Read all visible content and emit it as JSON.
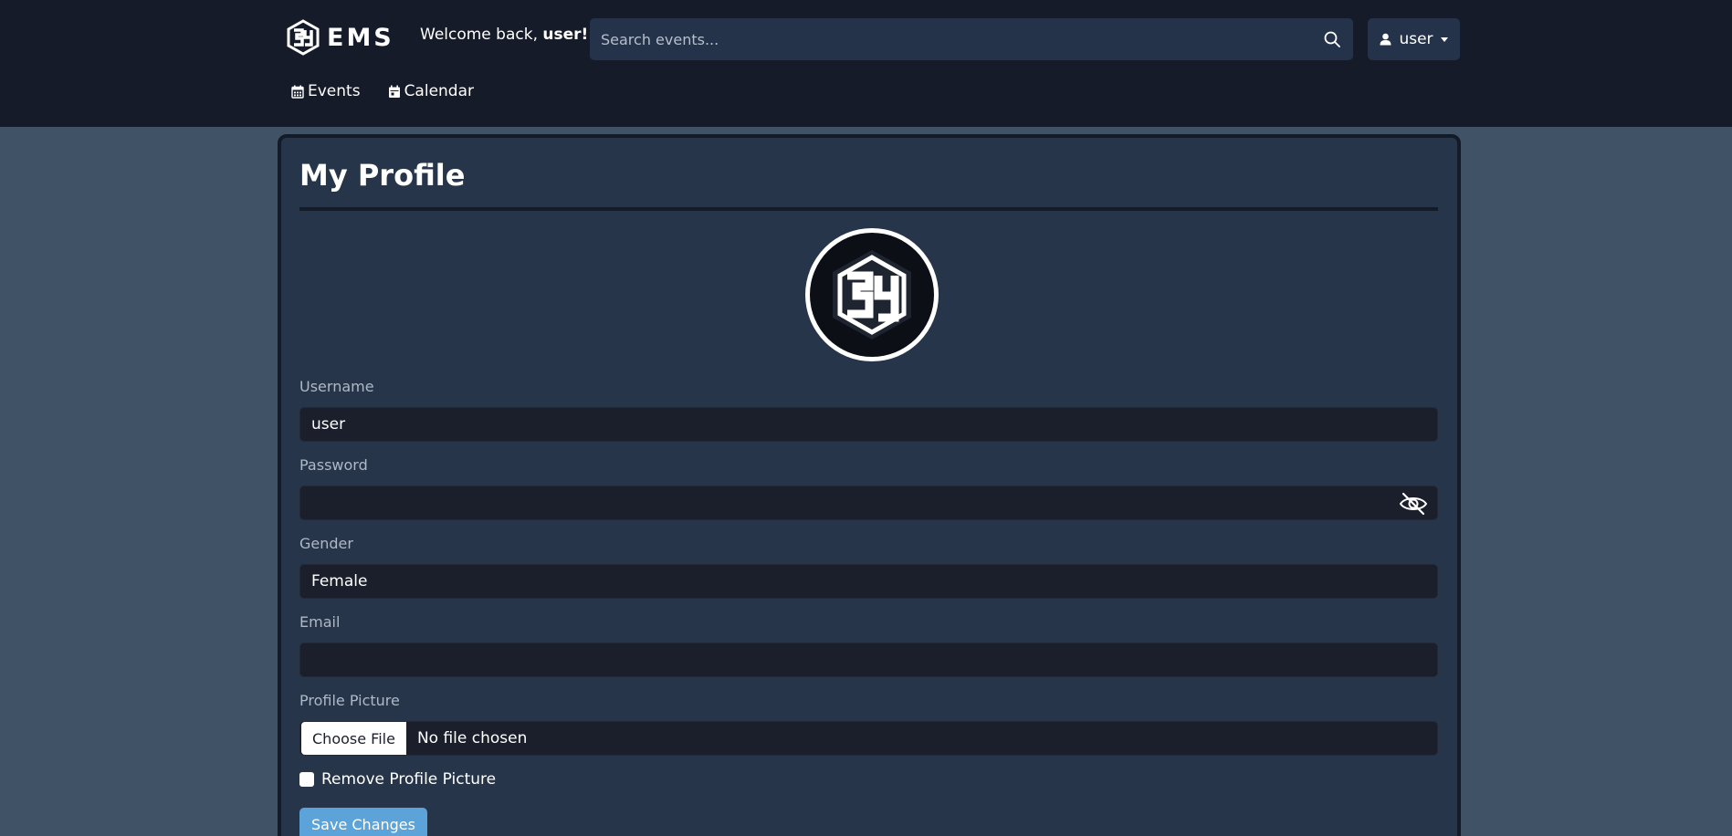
{
  "header": {
    "brand_text": "EMS",
    "welcome_prefix": "Welcome back, ",
    "welcome_user": "user!",
    "search_placeholder": "Search events...",
    "user_menu_label": "user"
  },
  "nav": {
    "events": "Events",
    "calendar": "Calendar"
  },
  "profile": {
    "title": "My Profile",
    "username_label": "Username",
    "username_value": "user",
    "password_label": "Password",
    "password_value": "",
    "gender_label": "Gender",
    "gender_value": "Female",
    "email_label": "Email",
    "email_value": "",
    "picture_label": "Profile Picture",
    "choose_file_label": "Choose File",
    "file_status": "No file chosen",
    "remove_picture_label": "Remove Profile Picture",
    "save_label": "Save Changes"
  },
  "colors": {
    "topbar": "#151b29",
    "page_bg": "#405266",
    "card_bg": "#27354a",
    "input_bg": "#1b1f2c",
    "save_button": "#5ba3d9"
  }
}
